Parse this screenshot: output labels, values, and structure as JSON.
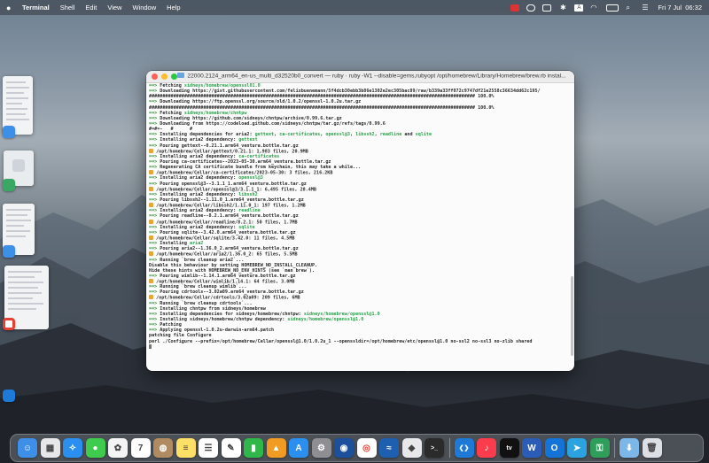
{
  "menubar": {
    "app_name": "Terminal",
    "items": [
      "Shell",
      "Edit",
      "View",
      "Window",
      "Help"
    ],
    "clock": "Fri 7 Jul  06:32"
  },
  "terminal": {
    "title": "22000.2124_arm64_en-us_multi_d32520b0_convert — ruby · ruby -W1 --disable=gems,rubyopt /opt/homebrew/Library/Homebrew/brew.rb instal...",
    "lines": [
      {
        "parts": [
          {
            "t": "==>",
            "c": "arrow"
          },
          {
            "t": " Fetching "
          },
          {
            "t": "sidneys/homebrew/openssl01.0",
            "c": "tg"
          }
        ]
      },
      {
        "parts": [
          {
            "t": "==>",
            "c": "arrow"
          },
          {
            "t": " Downloading https://gist.githubusercontent.com/felixbuenemann/5f4dcb30ebb3b86e1302e2ec305bac89/raw/b339a33ff072c9747df21e2558c36634dd62c195/"
          }
        ]
      },
      {
        "parts": [
          {
            "t": "######################################################################################################################## 100.0%"
          }
        ]
      },
      {
        "parts": [
          {
            "t": "==>",
            "c": "arrow"
          },
          {
            "t": " Downloading https://ftp.openssl.org/source/old/1.0.2/openssl-1.0.2u.tar.gz"
          }
        ]
      },
      {
        "parts": [
          {
            "t": "######################################################################################################################## 100.0%"
          }
        ]
      },
      {
        "parts": [
          {
            "t": "==>",
            "c": "arrow"
          },
          {
            "t": " Fetching "
          },
          {
            "t": "sidneys/homebrew/chntpw",
            "c": "tg"
          }
        ]
      },
      {
        "parts": [
          {
            "t": "==>",
            "c": "arrow"
          },
          {
            "t": " Downloading https://github.com/sidneys/chntpw/archive/0.99.6.tar.gz"
          }
        ]
      },
      {
        "parts": [
          {
            "t": "==>",
            "c": "arrow"
          },
          {
            "t": " Downloading from https://codeload.github.com/sidneys/chntpw/tar.gz/refs/tags/0.99.6"
          }
        ]
      },
      {
        "parts": [
          {
            "t": "#=#=-   #      #"
          }
        ]
      },
      {
        "parts": [
          {
            "t": "==>",
            "c": "arrow"
          },
          {
            "t": " Installing dependencies for aria2: "
          },
          {
            "t": "gettext",
            "c": "tg"
          },
          {
            "t": ", "
          },
          {
            "t": "ca-certificates",
            "c": "tg"
          },
          {
            "t": ", "
          },
          {
            "t": "openssl@3",
            "c": "tg"
          },
          {
            "t": ", "
          },
          {
            "t": "libssh2",
            "c": "tg"
          },
          {
            "t": ", "
          },
          {
            "t": "readline",
            "c": "tg"
          },
          {
            "t": " and "
          },
          {
            "t": "sqlite",
            "c": "tg"
          }
        ]
      },
      {
        "parts": [
          {
            "t": "==>",
            "c": "arrow"
          },
          {
            "t": " Installing aria2 dependency: "
          },
          {
            "t": "gettext",
            "c": "tg"
          }
        ]
      },
      {
        "parts": [
          {
            "t": "==>",
            "c": "arrow"
          },
          {
            "t": " Pouring gettext--0.21.1.arm64_ventura.bottle.tar.gz"
          }
        ]
      },
      {
        "beer": true,
        "parts": [
          {
            "t": " /opt/homebrew/Cellar/gettext/0.21.1: 1,983 files, 20.9MB"
          }
        ]
      },
      {
        "parts": [
          {
            "t": "==>",
            "c": "arrow"
          },
          {
            "t": " Installing aria2 dependency: "
          },
          {
            "t": "ca-certificates",
            "c": "tg"
          }
        ]
      },
      {
        "parts": [
          {
            "t": "==>",
            "c": "arrow"
          },
          {
            "t": " Pouring ca-certificates--2023-05-30.arm64_ventura.bottle.tar.gz"
          }
        ]
      },
      {
        "parts": [
          {
            "t": "==>",
            "c": "arrow"
          },
          {
            "t": " Regenerating CA certificate bundle from keychain, this may take a while..."
          }
        ]
      },
      {
        "beer": true,
        "parts": [
          {
            "t": " /opt/homebrew/Cellar/ca-certificates/2023-05-30: 3 files, 216.2KB"
          }
        ]
      },
      {
        "parts": [
          {
            "t": "==>",
            "c": "arrow"
          },
          {
            "t": " Installing aria2 dependency: "
          },
          {
            "t": "openssl@3",
            "c": "tg"
          }
        ]
      },
      {
        "parts": [
          {
            "t": "==>",
            "c": "arrow"
          },
          {
            "t": " Pouring openssl@3--3.1.1_1.arm64_ventura.bottle.tar.gz"
          }
        ]
      },
      {
        "beer": true,
        "parts": [
          {
            "t": " /opt/homebrew/Cellar/openssl@3/3.1.1_1: 6,495 files, 28.4MB"
          }
        ]
      },
      {
        "parts": [
          {
            "t": "==>",
            "c": "arrow"
          },
          {
            "t": " Installing aria2 dependency: "
          },
          {
            "t": "libssh2",
            "c": "tg"
          }
        ]
      },
      {
        "parts": [
          {
            "t": "==>",
            "c": "arrow"
          },
          {
            "t": " Pouring libssh2--1.11.0_1.arm64_ventura.bottle.tar.gz"
          }
        ]
      },
      {
        "beer": true,
        "parts": [
          {
            "t": " /opt/homebrew/Cellar/libssh2/1.11.0_1: 197 files, 1.2MB"
          }
        ]
      },
      {
        "parts": [
          {
            "t": "==>",
            "c": "arrow"
          },
          {
            "t": " Installing aria2 dependency: "
          },
          {
            "t": "readline",
            "c": "tg"
          }
        ]
      },
      {
        "parts": [
          {
            "t": "==>",
            "c": "arrow"
          },
          {
            "t": " Pouring readline--8.2.1.arm64_ventura.bottle.tar.gz"
          }
        ]
      },
      {
        "beer": true,
        "parts": [
          {
            "t": " /opt/homebrew/Cellar/readline/8.2.1: 50 files, 1.7MB"
          }
        ]
      },
      {
        "parts": [
          {
            "t": "==>",
            "c": "arrow"
          },
          {
            "t": " Installing aria2 dependency: "
          },
          {
            "t": "sqlite",
            "c": "tg"
          }
        ]
      },
      {
        "parts": [
          {
            "t": "==>",
            "c": "arrow"
          },
          {
            "t": " Pouring sqlite--3.42.0.arm64_ventura.bottle.tar.gz"
          }
        ]
      },
      {
        "beer": true,
        "parts": [
          {
            "t": " /opt/homebrew/Cellar/sqlite/3.42.0: 11 files, 4.5MB"
          }
        ]
      },
      {
        "parts": [
          {
            "t": "==>",
            "c": "arrow"
          },
          {
            "t": " Installing "
          },
          {
            "t": "aria2",
            "c": "tg"
          }
        ]
      },
      {
        "parts": [
          {
            "t": "==>",
            "c": "arrow"
          },
          {
            "t": " Pouring aria2--1.36.0_2.arm64_ventura.bottle.tar.gz"
          }
        ]
      },
      {
        "beer": true,
        "parts": [
          {
            "t": " /opt/homebrew/Cellar/aria2/1.36.0_2: 65 files, 5.5MB"
          }
        ]
      },
      {
        "parts": [
          {
            "t": "==>",
            "c": "arrow"
          },
          {
            "t": " Running `brew cleanup aria2`..."
          }
        ]
      },
      {
        "parts": [
          {
            "t": "Disable this behaviour by setting HOMEBREW_NO_INSTALL_CLEANUP."
          }
        ]
      },
      {
        "parts": [
          {
            "t": "Hide these hints with HOMEBREW_NO_ENV_HINTS (see `man brew`)."
          }
        ]
      },
      {
        "parts": [
          {
            "t": "==>",
            "c": "arrow"
          },
          {
            "t": " Pouring wimlib--1.14.1.arm64_ventura.bottle.tar.gz"
          }
        ]
      },
      {
        "beer": true,
        "parts": [
          {
            "t": " /opt/homebrew/Cellar/wimlib/1.14.1: 64 files, 3.0MB"
          }
        ]
      },
      {
        "parts": [
          {
            "t": "==>",
            "c": "arrow"
          },
          {
            "t": " Running `brew cleanup wimlib`..."
          }
        ]
      },
      {
        "parts": [
          {
            "t": "==>",
            "c": "arrow"
          },
          {
            "t": " Pouring cdrtools--3.02a09.arm64_ventura.bottle.tar.gz"
          }
        ]
      },
      {
        "beer": true,
        "parts": [
          {
            "t": " /opt/homebrew/Cellar/cdrtools/3.02a09: 209 files, 6MB"
          }
        ]
      },
      {
        "parts": [
          {
            "t": "==>",
            "c": "arrow"
          },
          {
            "t": " Running `brew cleanup cdrtools`..."
          }
        ]
      },
      {
        "parts": [
          {
            "t": "==>",
            "c": "arrow"
          },
          {
            "t": " Installing chntpw from sidneys/homebrew"
          }
        ]
      },
      {
        "parts": [
          {
            "t": "==>",
            "c": "arrow"
          },
          {
            "t": " Installing dependencies for sidneys/homebrew/chntpw: "
          },
          {
            "t": "sidneys/homebrew/openssl@1.0",
            "c": "tg"
          }
        ]
      },
      {
        "parts": [
          {
            "t": "==>",
            "c": "arrow"
          },
          {
            "t": " Installing sidneys/homebrew/chntpw dependency: "
          },
          {
            "t": "sidneys/homebrew/openssl@1.0",
            "c": "tg"
          }
        ]
      },
      {
        "parts": [
          {
            "t": "==>",
            "c": "arrow"
          },
          {
            "t": " Patching"
          }
        ]
      },
      {
        "parts": [
          {
            "t": "==>",
            "c": "arrow"
          },
          {
            "t": " Applying openssl-1.0.2u-darwin-arm64.patch"
          }
        ]
      },
      {
        "parts": [
          {
            "t": "patching file Configure"
          }
        ]
      },
      {
        "parts": [
          {
            "t": "perl ./Configure --prefix=/opt/homebrew/Cellar/openssl@1.0/1.0.2u_1 --openssldir=/opt/homebrew/etc/openssl@1.0 no-ssl2 no-ssl3 no-zlib shared"
          }
        ]
      }
    ]
  },
  "dock": {
    "apps": [
      {
        "name": "finder-icon",
        "color": "#3d8fe8",
        "glyph": "☺"
      },
      {
        "name": "launchpad-icon",
        "color": "#e7e7ea",
        "glyph": "▦"
      },
      {
        "name": "safari-icon",
        "color": "#2a8fef",
        "glyph": "✧"
      },
      {
        "name": "messages-icon",
        "color": "#3fcb4d",
        "glyph": "●"
      },
      {
        "name": "photos-icon",
        "color": "#f4f4f4",
        "glyph": "✿"
      },
      {
        "name": "calendar-icon",
        "color": "#ffffff",
        "glyph": "7"
      },
      {
        "name": "contacts-icon",
        "color": "#b08a60",
        "glyph": "◍"
      },
      {
        "name": "notes-icon",
        "color": "#ffe066",
        "glyph": "≡"
      },
      {
        "name": "reminders-icon",
        "color": "#ffffff",
        "glyph": "☰"
      },
      {
        "name": "freeform-icon",
        "color": "#ffffff",
        "glyph": "✎"
      },
      {
        "name": "numbers-icon",
        "color": "#2fb74a",
        "glyph": "▮"
      },
      {
        "name": "keynote-icon",
        "color": "#f29b22",
        "glyph": "▲"
      },
      {
        "name": "app-store-icon",
        "color": "#2a8fef",
        "glyph": "A"
      },
      {
        "name": "system-settings-icon",
        "color": "#8e8e93",
        "glyph": "⚙"
      },
      {
        "name": "vpn-icon",
        "color": "#1c4f9c",
        "glyph": "◉"
      },
      {
        "name": "chrome-icon",
        "color": "#ffffff",
        "glyph": "◎"
      },
      {
        "name": "surfshark-icon",
        "color": "#1f5fb0",
        "glyph": "≈"
      },
      {
        "name": "github-icon",
        "color": "#e8e8ea",
        "glyph": "◆"
      },
      {
        "name": "terminal-icon",
        "color": "#2b2b2b",
        "glyph": ">_"
      },
      {
        "name": "vscode-icon",
        "color": "#1e7ad6",
        "glyph": "❮❯"
      },
      {
        "name": "music-icon",
        "color": "#fa3c4c",
        "glyph": "♪"
      },
      {
        "name": "apple-tv-icon",
        "color": "#111111",
        "glyph": "tv"
      },
      {
        "name": "word-icon",
        "color": "#2b5cb8",
        "glyph": "W"
      },
      {
        "name": "outlook-icon",
        "color": "#1473d6",
        "glyph": "O"
      },
      {
        "name": "telegram-icon",
        "color": "#2aa3e0",
        "glyph": "➤"
      },
      {
        "name": "authenticator-icon",
        "color": "#2f9e5a",
        "glyph": "⚿"
      },
      {
        "name": "downloads-folder-icon",
        "color": "#7cb7e8",
        "glyph": "⬇"
      },
      {
        "name": "trash-icon",
        "color": "#dcdfe3",
        "glyph": "🗑"
      }
    ]
  }
}
